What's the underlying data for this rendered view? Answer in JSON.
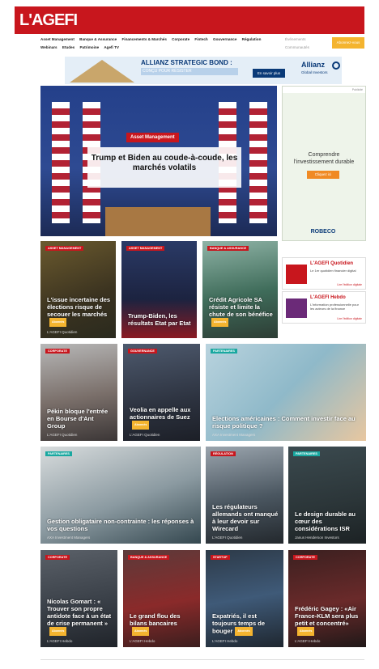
{
  "header": {
    "logo": "L'AGEFI"
  },
  "nav": {
    "items": [
      "Asset Management",
      "Banque & Assurance",
      "Financements & Marchés",
      "Corporate",
      "Fintech",
      "Gouvernance",
      "Régulation",
      "Webinars",
      "Etudes",
      "Patrimoine",
      "Agefi TV"
    ],
    "right": [
      "Événements",
      "Communautés"
    ],
    "subscribe": "Abonnez-vous"
  },
  "banner": {
    "title": "ALLIANZ STRATEGIC BOND :",
    "subtitle": "CONÇU POUR RÉSISTER",
    "cta": "En savoir plus",
    "brand": "Allianz",
    "brand_sub": "Global Investors"
  },
  "hero": {
    "tag": "Asset Management",
    "title": "Trump et Biden au coude-à-coude, les marchés volatils"
  },
  "ad": {
    "headline": "Comprendre l'investissement durable",
    "cta": "Cliquez ici",
    "brand": "ROBECO",
    "label": "Publicité"
  },
  "promos": [
    {
      "title": "L'AGEFI Quotidien",
      "text": "Le 1er quotidien financier digital",
      "link": "Lire l'édition digitale"
    },
    {
      "title": "L'AGEFI Hebdo",
      "text": "L'information professionnelle pour les acteurs de la finance",
      "link": "Lire l'édition digitale"
    }
  ],
  "articles": [
    {
      "tag": "Asset Management",
      "title": "L'issue incertaine des élections risque de secouer les marchés",
      "source": "L'AGEFI Quotidien",
      "badge": "Abonnés"
    },
    {
      "tag": "Asset Management",
      "title": "Trump-Biden, les résultats Etat par Etat",
      "source": "",
      "badge": ""
    },
    {
      "tag": "Banque & Assurance",
      "title": "Crédit Agricole SA résiste et limite la chute de son bénéfice",
      "source": "",
      "badge": "Abonnés"
    },
    {
      "tag": "Corporate",
      "title": "Pékin bloque l'entrée en Bourse d'Ant Group",
      "source": "L'AGEFI Quotidien",
      "badge": ""
    },
    {
      "tag": "Gouvernance",
      "title": "Veolia en appelle aux actionnaires de Suez",
      "source": "L'AGEFI Quotidien",
      "badge": "Abonnés"
    },
    {
      "tag": "Partenaires",
      "title": "Elections américaines : Comment investir face au risque politique ?",
      "source": "AXA Investment Managers",
      "badge": ""
    },
    {
      "tag": "Partenaires",
      "title": "Gestion obligataire non-contrainte : les réponses à vos questions",
      "source": "AXA Investment Managers",
      "badge": ""
    },
    {
      "tag": "Régulation",
      "title": "Les régulateurs allemands ont manqué à leur devoir sur Wirecard",
      "source": "L'AGEFI Quotidien",
      "badge": ""
    },
    {
      "tag": "Partenaires",
      "title": "Le design durable au cœur des considérations ISR",
      "source": "Janus Henderson Investors",
      "badge": ""
    },
    {
      "tag": "Corporate",
      "title": "Nicolas Gomart : « Trouver son propre antidote face à un état de crise permanent »",
      "source": "L'AGEFI Hebdo",
      "badge": "Abonnés"
    },
    {
      "tag": "Banque & Assurance",
      "title": "Le grand flou des bilans bancaires",
      "source": "L'AGEFI Hebdo",
      "badge": "Abonnés"
    },
    {
      "tag": "Startup",
      "title": "Expatriés, il est toujours temps de bouger",
      "source": "L'AGEFI Hebdo",
      "badge": "Abonnés"
    },
    {
      "tag": "Corporate",
      "title": "Frédéric Gagey : «Air France-KLM sera plus petit et concentré»",
      "source": "L'AGEFI Hebdo",
      "badge": "Abonnés"
    }
  ],
  "colors": {
    "brand": "#c8161d",
    "accent": "#f4b42f",
    "teal": "#19a8a0"
  }
}
